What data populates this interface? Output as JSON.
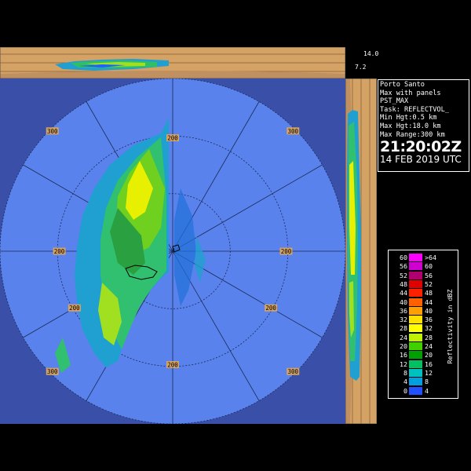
{
  "info": {
    "station": "Porto Santo",
    "product": "Max with panels",
    "product_code": "PST_MAX",
    "task": "Task: REFLECTVOL_",
    "min_hgt": "Min Hgt:0.5 km",
    "max_hgt": "Max Hgt:18.0 km",
    "max_range": "Max Range:300 km",
    "time": "21:20:02Z",
    "date": "14 FEB 2019 UTC"
  },
  "panels": {
    "top_scale_high": "14.0",
    "top_scale_low": "7.2"
  },
  "range_labels": [
    {
      "text": "300",
      "range_km": 300,
      "bearing_deg": 315
    },
    {
      "text": "300",
      "range_km": 300,
      "bearing_deg": 45
    },
    {
      "text": "300",
      "range_km": 300,
      "bearing_deg": 225
    },
    {
      "text": "300",
      "range_km": 300,
      "bearing_deg": 135
    },
    {
      "text": "200",
      "range_km": 200,
      "bearing_deg": 0
    },
    {
      "text": "200",
      "range_km": 200,
      "bearing_deg": 180
    },
    {
      "text": "200",
      "range_km": 200,
      "bearing_deg": 270
    },
    {
      "text": "200",
      "range_km": 200,
      "bearing_deg": 90
    },
    {
      "text": "200",
      "range_km": 200,
      "bearing_deg": 240
    },
    {
      "text": "200",
      "range_km": 200,
      "bearing_deg": 120
    }
  ],
  "legend": {
    "title": "Reflectivity in dBZ",
    "rows": [
      {
        "left": "60",
        "right": ">64",
        "color": "#ff00ff"
      },
      {
        "left": "56",
        "right": "60",
        "color": "#d000d0"
      },
      {
        "left": "52",
        "right": "56",
        "color": "#b00070"
      },
      {
        "left": "48",
        "right": "52",
        "color": "#e00000"
      },
      {
        "left": "44",
        "right": "48",
        "color": "#ff2000"
      },
      {
        "left": "40",
        "right": "44",
        "color": "#ff6000"
      },
      {
        "left": "36",
        "right": "40",
        "color": "#ffa000"
      },
      {
        "left": "32",
        "right": "36",
        "color": "#ffe000"
      },
      {
        "left": "28",
        "right": "32",
        "color": "#ffff00"
      },
      {
        "left": "24",
        "right": "28",
        "color": "#c0f000"
      },
      {
        "left": "20",
        "right": "24",
        "color": "#40d000"
      },
      {
        "left": "16",
        "right": "20",
        "color": "#00a000"
      },
      {
        "left": "12",
        "right": "16",
        "color": "#00c060"
      },
      {
        "left": "8",
        "right": "12",
        "color": "#00c0c0"
      },
      {
        "left": "4",
        "right": "8",
        "color": "#00a0e0"
      },
      {
        "left": "0",
        "right": "4",
        "color": "#2050ff"
      }
    ]
  },
  "colors": {
    "background": "#000000",
    "outside_range": "#3a50a8",
    "inside_range": "#5a82ec",
    "panel_tan": "#d4a265",
    "ring_line": "#1a2a55"
  }
}
